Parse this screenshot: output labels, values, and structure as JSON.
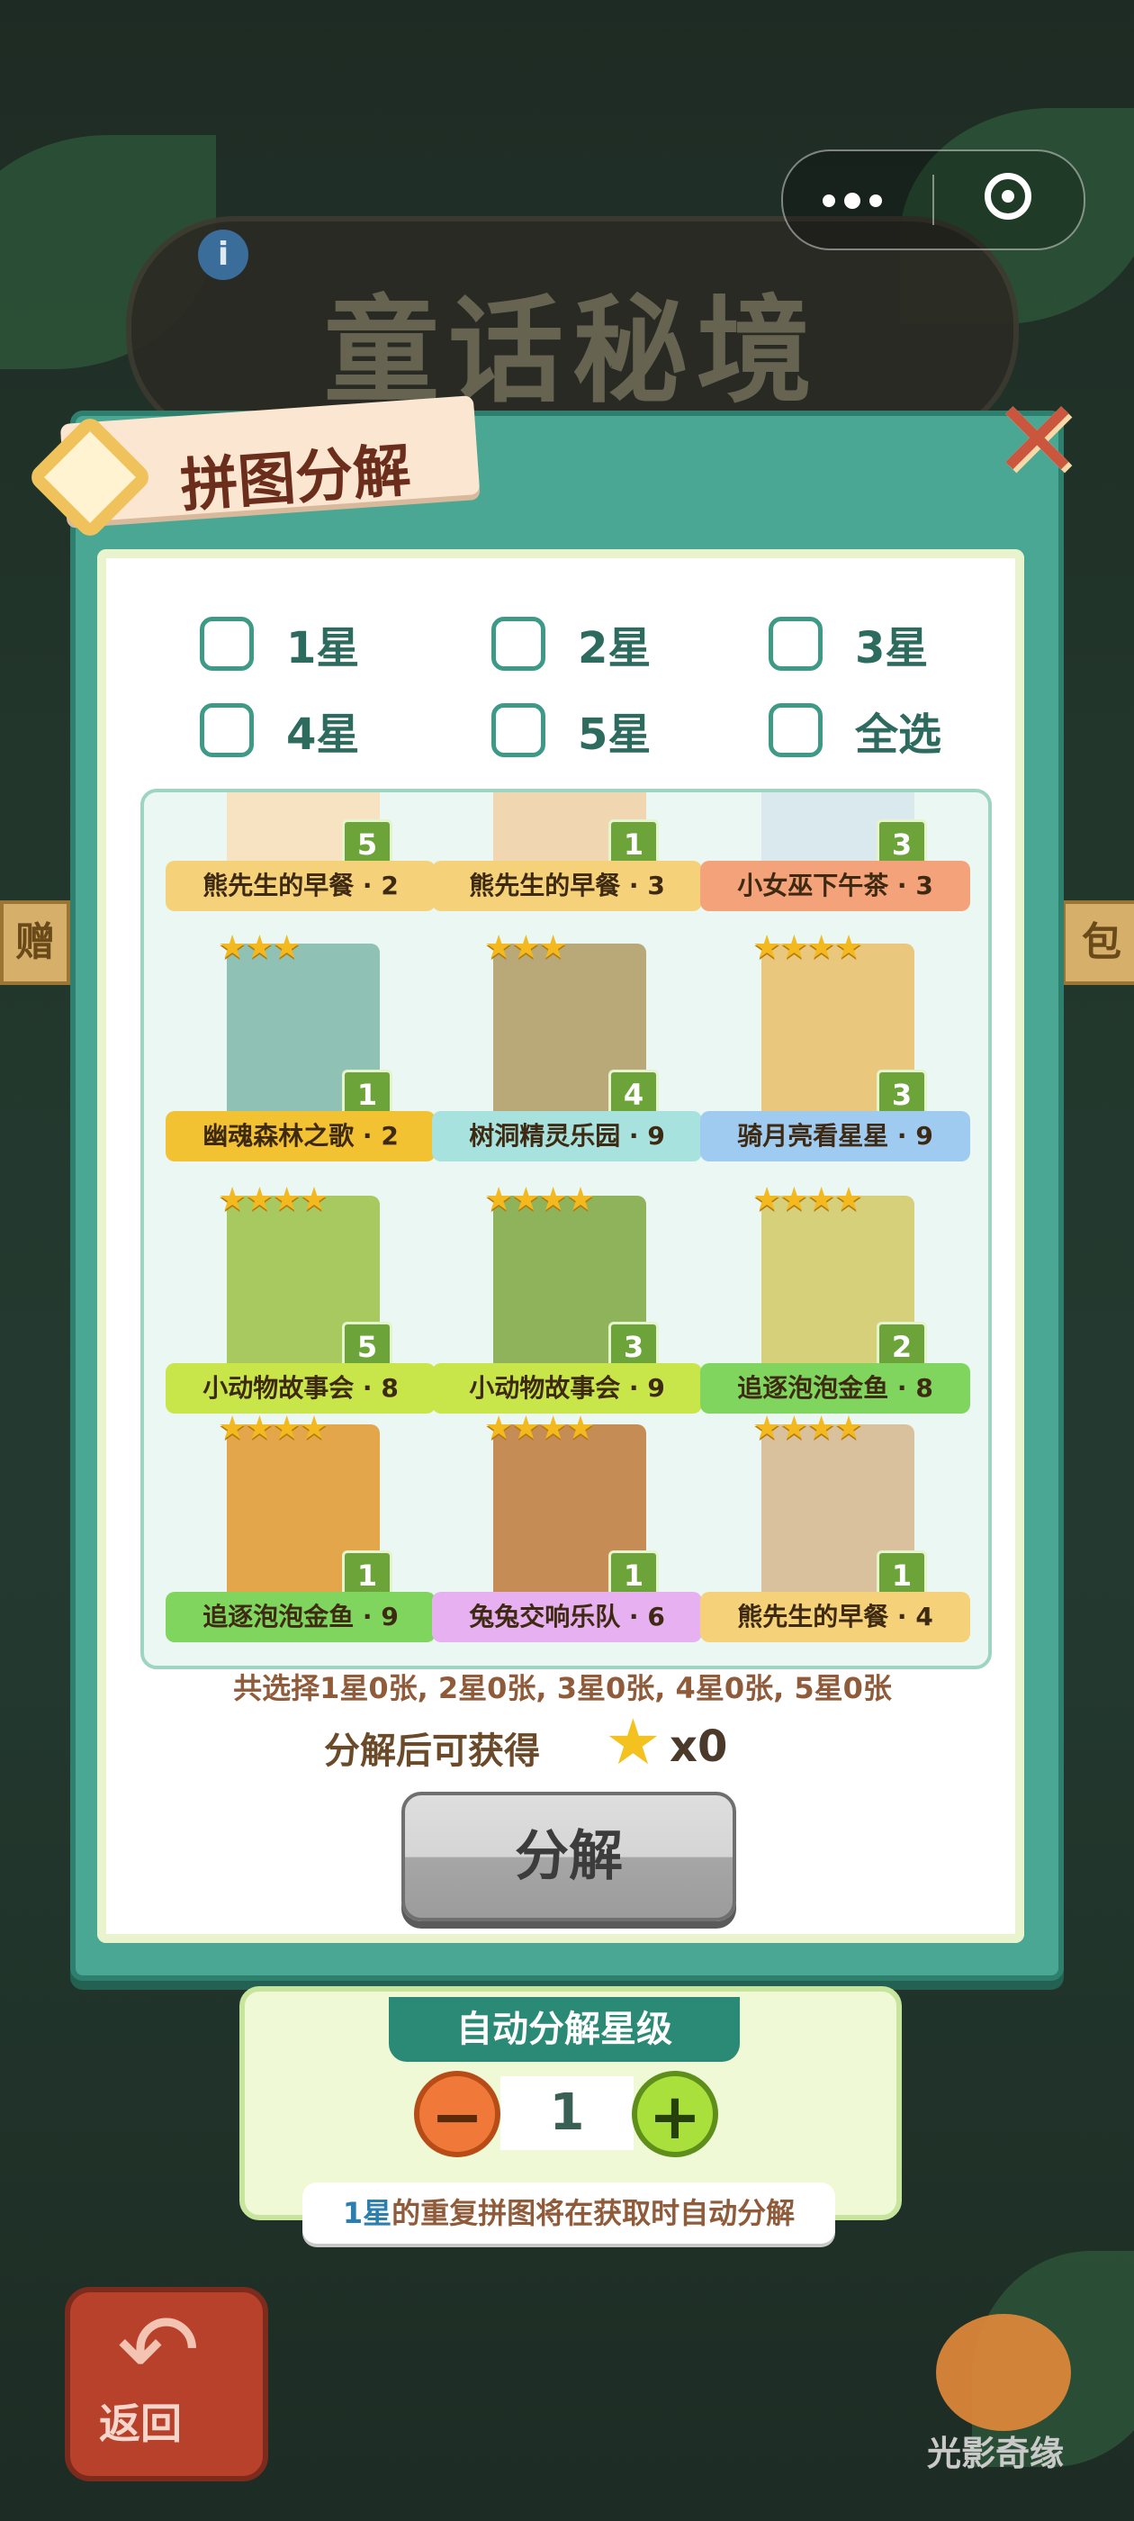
{
  "game": {
    "title": "童话秘境",
    "brand": "光影奇缘"
  },
  "top_bar": {
    "capsule_menu": "more-dots-icon",
    "capsule_close": "target-icon"
  },
  "background": {
    "left_banner": "赠",
    "right_banner": "包"
  },
  "modal": {
    "title": "拼图分解",
    "close_icon": "close-icon",
    "filters": [
      {
        "label": "1星"
      },
      {
        "label": "2星"
      },
      {
        "label": "3星"
      },
      {
        "label": "4星"
      },
      {
        "label": "5星"
      },
      {
        "label": "全选"
      }
    ],
    "cards": [
      {
        "name": "熊先生的早餐 · 2",
        "count": "5",
        "stars": "",
        "color": "#f5d27a",
        "art": "#f7e3c2"
      },
      {
        "name": "熊先生的早餐 · 3",
        "count": "1",
        "stars": "",
        "color": "#f5d27a",
        "art": "#f0d7b2"
      },
      {
        "name": "小女巫下午茶 · 3",
        "count": "3",
        "stars": "",
        "color": "#f4a27a",
        "art": "#d9e9ee"
      },
      {
        "name": "幽魂森林之歌 · 2",
        "count": "1",
        "stars": "★★★",
        "color": "#f2c233",
        "art": "#8fc1b4"
      },
      {
        "name": "树洞精灵乐园 · 9",
        "count": "4",
        "stars": "★★★",
        "color": "#a7e2df",
        "art": "#b9a978"
      },
      {
        "name": "骑月亮看星星 · 9",
        "count": "3",
        "stars": "★★★★",
        "color": "#9fcbf1",
        "art": "#e9c87d"
      },
      {
        "name": "小动物故事会 · 8",
        "count": "5",
        "stars": "★★★★",
        "color": "#c8e64a",
        "art": "#a8c860"
      },
      {
        "name": "小动物故事会 · 9",
        "count": "3",
        "stars": "★★★★",
        "color": "#c8e64a",
        "art": "#8fb35a"
      },
      {
        "name": "追逐泡泡金鱼 · 8",
        "count": "2",
        "stars": "★★★★",
        "color": "#7fd55e",
        "art": "#d6d07a"
      },
      {
        "name": "追逐泡泡金鱼 · 9",
        "count": "1",
        "stars": "★★★★",
        "color": "#7fd55e",
        "art": "#e3a64a"
      },
      {
        "name": "兔兔交响乐队 · 6",
        "count": "1",
        "stars": "★★★★",
        "color": "#e7b0f0",
        "art": "#c58d55"
      },
      {
        "name": "熊先生的早餐 · 4",
        "count": "1",
        "stars": "★★★★",
        "color": "#f5d27a",
        "art": "#d9c19e"
      }
    ],
    "summary": "共选择1星0张, 2星0张, 3星0张, 4星0张, 5星0张",
    "obtain_label": "分解后可获得",
    "obtain_count": "x0",
    "decompose_button": "分解"
  },
  "auto_panel": {
    "title": "自动分解星级",
    "level": "1",
    "minus": "−",
    "plus": "+",
    "hint_blue": "1星",
    "hint_rest": "的重复拼图将在获取时自动分解"
  },
  "footer": {
    "back_label": "返回"
  }
}
